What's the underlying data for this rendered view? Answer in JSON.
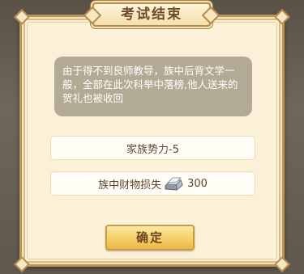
{
  "dialog": {
    "title": "考试结束",
    "message": "由于得不到良师教导，族中后背文学一般，全部在此次科举中落榜,他人送来的贺礼也被收回",
    "influence_text": "家族势力-5",
    "wealth_loss_label": "族中财物损失",
    "wealth_loss_value": "300",
    "wealth_icon": "silver-ingot-icon",
    "confirm_label": "确定"
  },
  "colors": {
    "panel_bg": "#fbf1d8",
    "panel_border": "#b9955c",
    "message_bg": "#b3aa95",
    "button_gold": "#f6cf67",
    "title_text": "#6f4a2a"
  }
}
